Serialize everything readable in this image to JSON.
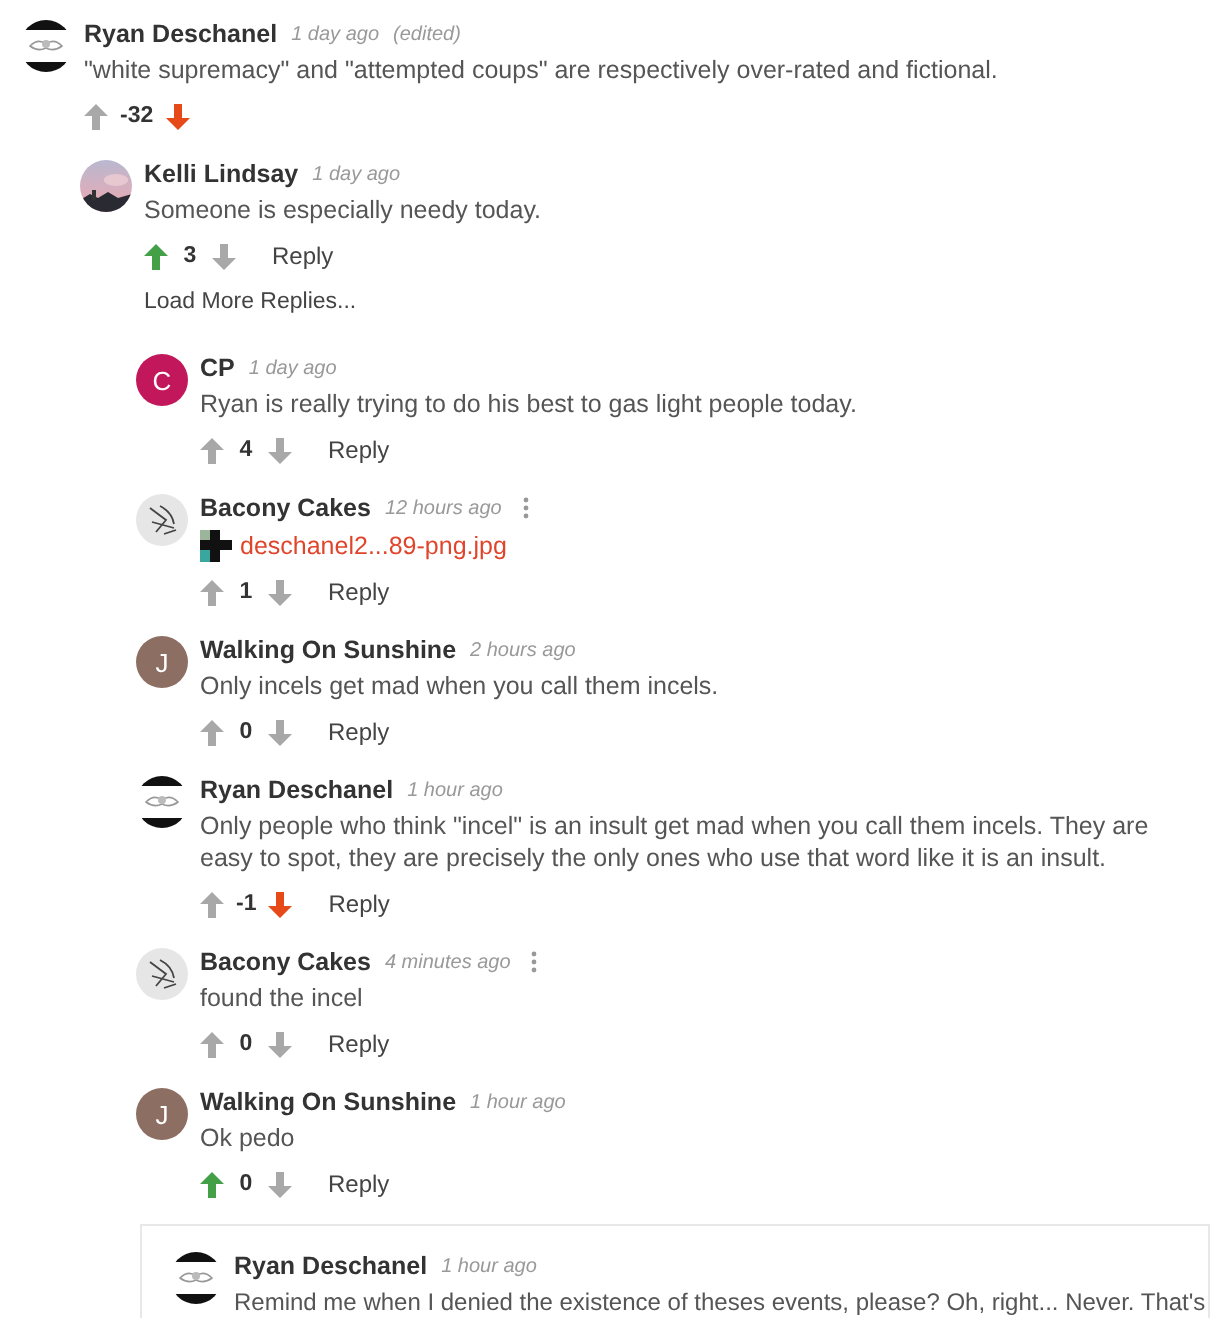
{
  "comments": [
    {
      "author": "Ryan Deschanel",
      "time": "1 day ago",
      "edited": "(edited)",
      "avatar": {
        "kind": "drawn"
      },
      "text": "\"white supremacy\" and \"attempted coups\" are respectively over-rated and fictional.",
      "score": "-32",
      "upvoted": false,
      "downvoted": true,
      "children": [
        {
          "author": "Kelli Lindsay",
          "time": "1 day ago",
          "text": "Someone is especially needy today.",
          "score": "3",
          "upvoted": true,
          "downvoted": false,
          "reply": "Reply",
          "load_more": "Load More Replies...",
          "children": [
            {
              "author": "CP",
              "time": "1 day ago",
              "avatar": {
                "kind": "letter",
                "letter": "C",
                "color": "#c2185b"
              },
              "text": "Ryan is really trying to do his best to gas light people today.",
              "score": "4",
              "upvoted": false,
              "downvoted": false,
              "reply": "Reply"
            },
            {
              "author": "Bacony Cakes",
              "time": "12 hours ago",
              "menu": true,
              "avatar": {
                "kind": "sketch"
              },
              "attachment": "deschanel2...89-png.jpg",
              "score": "1",
              "upvoted": false,
              "downvoted": false,
              "reply": "Reply"
            },
            {
              "author": "Walking On Sunshine",
              "time": "2 hours ago",
              "avatar": {
                "kind": "letter",
                "letter": "J",
                "color": "#8d6e63"
              },
              "text": "Only incels get mad when you call them incels.",
              "score": "0",
              "upvoted": false,
              "downvoted": false,
              "reply": "Reply"
            },
            {
              "author": "Ryan Deschanel",
              "time": "1 hour ago",
              "avatar": {
                "kind": "drawn"
              },
              "text": "Only people who think \"incel\" is an insult get mad when you call them incels. They are easy to spot, they are precisely the only ones who use that word like it is an insult.",
              "score": "-1",
              "upvoted": false,
              "downvoted": true,
              "reply": "Reply"
            },
            {
              "author": "Bacony Cakes",
              "time": "4 minutes ago",
              "menu": true,
              "avatar": {
                "kind": "sketch"
              },
              "text": "found the incel",
              "score": "0",
              "upvoted": false,
              "downvoted": false,
              "reply": "Reply"
            },
            {
              "author": "Walking On Sunshine",
              "time": "1 hour ago",
              "avatar": {
                "kind": "letter",
                "letter": "J",
                "color": "#8d6e63"
              },
              "text": "Ok pedo",
              "score": "0",
              "upvoted": true,
              "downvoted": false,
              "reply": "Reply",
              "children": [
                {
                  "author": "Ryan Deschanel",
                  "time": "1 hour ago",
                  "highlighted": true,
                  "avatar": {
                    "kind": "drawn"
                  },
                  "text": "Remind me when I denied the existence of theses events, please? Oh, right... Never. That's"
                }
              ]
            }
          ]
        }
      ]
    }
  ]
}
